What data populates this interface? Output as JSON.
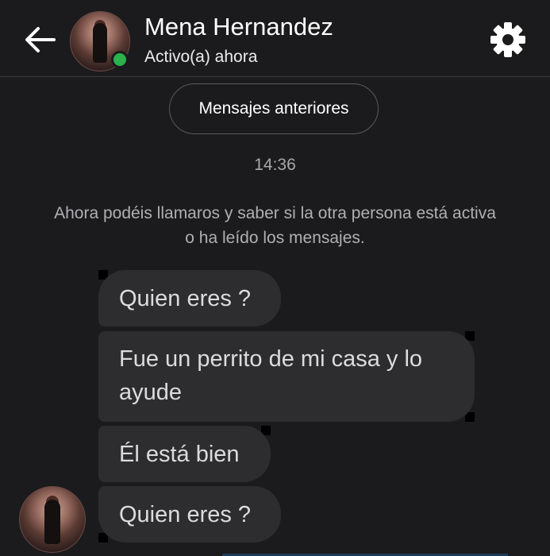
{
  "header": {
    "back_icon": "arrow-left-icon",
    "contact_name": "Mena Hernandez",
    "status": "Activo(a) ahora",
    "settings_icon": "gear-icon",
    "online_color": "#2bb24c"
  },
  "conversation": {
    "older_messages_label": "Mensajes anteriores",
    "timestamp": "14:36",
    "system_note": "Ahora podéis llamaros y saber si la otra persona está activa o ha leído los mensajes.",
    "messages": [
      {
        "text": "Quien eres ?"
      },
      {
        "text": "Fue un perrito de mi casa y lo ayude"
      },
      {
        "text": "Él está bien"
      },
      {
        "text": "Quien eres ?"
      }
    ]
  },
  "colors": {
    "background": "#1b1b1d",
    "bubble": "#2d2d2f",
    "bubble_text": "#dcdcdc"
  }
}
